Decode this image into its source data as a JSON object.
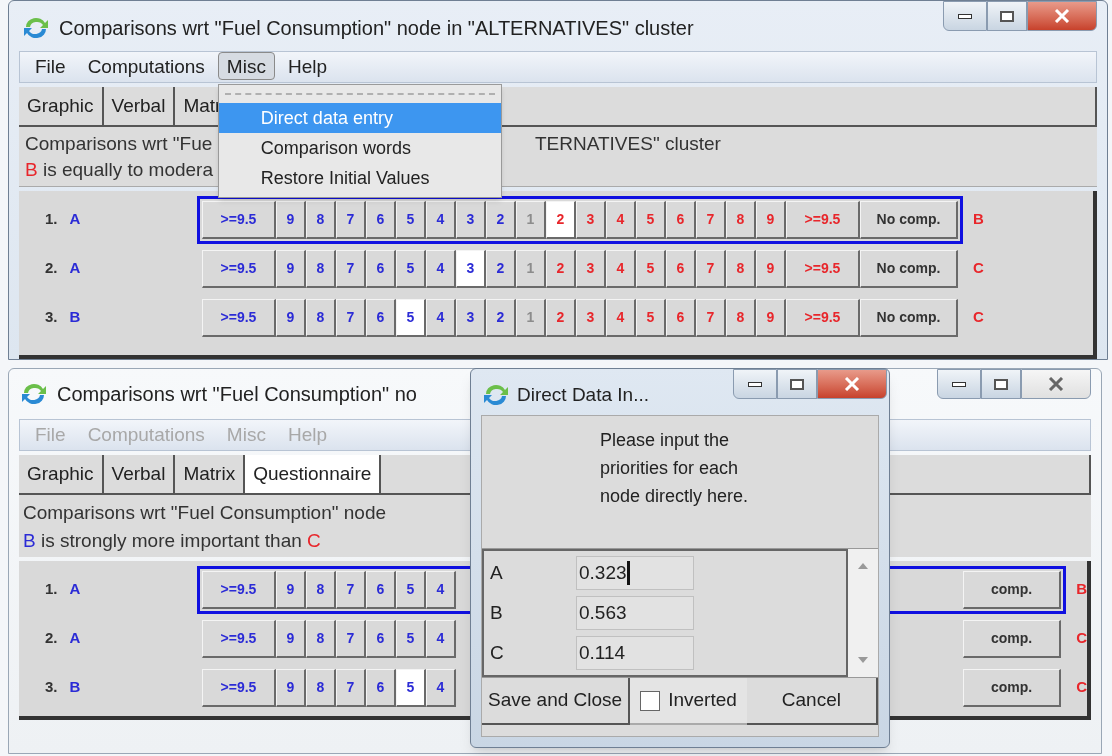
{
  "top_window": {
    "title": "Comparisons wrt \"Fuel Consumption\" node in \"ALTERNATIVES\" cluster",
    "menu": [
      {
        "label": "File",
        "open": false,
        "disabled": false
      },
      {
        "label": "Computations",
        "open": false,
        "disabled": false
      },
      {
        "label": "Misc",
        "open": true,
        "disabled": false
      },
      {
        "label": "Help",
        "open": false,
        "disabled": false
      }
    ],
    "dropdown": [
      {
        "label": "Direct data entry",
        "selected": true
      },
      {
        "label": "Comparison words",
        "selected": false
      },
      {
        "label": "Restore Initial Values",
        "selected": false
      }
    ],
    "tabs": [
      {
        "label": "Graphic",
        "selected": false
      },
      {
        "label": "Verbal",
        "selected": false
      },
      {
        "label": "Matr",
        "selected": false
      }
    ],
    "description": {
      "line1_left": "Comparisons wrt \"Fue",
      "line1_right": "TERNATIVES\" cluster",
      "line2": [
        {
          "text": "B",
          "color": "#e8262b"
        },
        {
          "text": " is equally to modera",
          "color": "#333333"
        }
      ]
    },
    "rows": [
      {
        "number": "1.",
        "left": "A",
        "right": "B",
        "focused": true,
        "cells": [
          {
            "label": ">=9.5",
            "kind": "maxmore",
            "selected": false
          },
          {
            "label": "9",
            "kind": "more",
            "selected": false
          },
          {
            "label": "8",
            "kind": "more",
            "selected": false
          },
          {
            "label": "7",
            "kind": "more",
            "selected": false
          },
          {
            "label": "6",
            "kind": "more",
            "selected": false
          },
          {
            "label": "5",
            "kind": "more",
            "selected": false
          },
          {
            "label": "4",
            "kind": "more",
            "selected": false
          },
          {
            "label": "3",
            "kind": "more",
            "selected": false
          },
          {
            "label": "2",
            "kind": "more",
            "selected": false
          },
          {
            "label": "1",
            "kind": "equal",
            "selected": false
          },
          {
            "label": "2",
            "kind": "less",
            "selected": true
          },
          {
            "label": "3",
            "kind": "less",
            "selected": false
          },
          {
            "label": "4",
            "kind": "less",
            "selected": false
          },
          {
            "label": "5",
            "kind": "less",
            "selected": false
          },
          {
            "label": "6",
            "kind": "less",
            "selected": false
          },
          {
            "label": "7",
            "kind": "less",
            "selected": false
          },
          {
            "label": "8",
            "kind": "less",
            "selected": false
          },
          {
            "label": "9",
            "kind": "less",
            "selected": false
          },
          {
            "label": ">=9.5",
            "kind": "maxless",
            "selected": false
          },
          {
            "label": "No comp.",
            "kind": "none",
            "selected": false
          }
        ]
      },
      {
        "number": "2.",
        "left": "A",
        "right": "C",
        "focused": false,
        "cells": [
          {
            "label": ">=9.5",
            "kind": "maxmore",
            "selected": false
          },
          {
            "label": "9",
            "kind": "more",
            "selected": false
          },
          {
            "label": "8",
            "kind": "more",
            "selected": false
          },
          {
            "label": "7",
            "kind": "more",
            "selected": false
          },
          {
            "label": "6",
            "kind": "more",
            "selected": false
          },
          {
            "label": "5",
            "kind": "more",
            "selected": false
          },
          {
            "label": "4",
            "kind": "more",
            "selected": false
          },
          {
            "label": "3",
            "kind": "more",
            "selected": true
          },
          {
            "label": "2",
            "kind": "more",
            "selected": false
          },
          {
            "label": "1",
            "kind": "equal",
            "selected": false
          },
          {
            "label": "2",
            "kind": "less",
            "selected": false
          },
          {
            "label": "3",
            "kind": "less",
            "selected": false
          },
          {
            "label": "4",
            "kind": "less",
            "selected": false
          },
          {
            "label": "5",
            "kind": "less",
            "selected": false
          },
          {
            "label": "6",
            "kind": "less",
            "selected": false
          },
          {
            "label": "7",
            "kind": "less",
            "selected": false
          },
          {
            "label": "8",
            "kind": "less",
            "selected": false
          },
          {
            "label": "9",
            "kind": "less",
            "selected": false
          },
          {
            "label": ">=9.5",
            "kind": "maxless",
            "selected": false
          },
          {
            "label": "No comp.",
            "kind": "none",
            "selected": false
          }
        ]
      },
      {
        "number": "3.",
        "left": "B",
        "right": "C",
        "focused": false,
        "cells": [
          {
            "label": ">=9.5",
            "kind": "maxmore",
            "selected": false
          },
          {
            "label": "9",
            "kind": "more",
            "selected": false
          },
          {
            "label": "8",
            "kind": "more",
            "selected": false
          },
          {
            "label": "7",
            "kind": "more",
            "selected": false
          },
          {
            "label": "6",
            "kind": "more",
            "selected": false
          },
          {
            "label": "5",
            "kind": "more",
            "selected": true
          },
          {
            "label": "4",
            "kind": "more",
            "selected": false
          },
          {
            "label": "3",
            "kind": "more",
            "selected": false
          },
          {
            "label": "2",
            "kind": "more",
            "selected": false
          },
          {
            "label": "1",
            "kind": "equal",
            "selected": false
          },
          {
            "label": "2",
            "kind": "less",
            "selected": false
          },
          {
            "label": "3",
            "kind": "less",
            "selected": false
          },
          {
            "label": "4",
            "kind": "less",
            "selected": false
          },
          {
            "label": "5",
            "kind": "less",
            "selected": false
          },
          {
            "label": "6",
            "kind": "less",
            "selected": false
          },
          {
            "label": "7",
            "kind": "less",
            "selected": false
          },
          {
            "label": "8",
            "kind": "less",
            "selected": false
          },
          {
            "label": "9",
            "kind": "less",
            "selected": false
          },
          {
            "label": ">=9.5",
            "kind": "maxless",
            "selected": false
          },
          {
            "label": "No comp.",
            "kind": "none",
            "selected": false
          }
        ]
      }
    ]
  },
  "bottom_window": {
    "title": "Comparisons wrt \"Fuel Consumption\" no",
    "menu": [
      {
        "label": "File",
        "open": false,
        "disabled": true
      },
      {
        "label": "Computations",
        "open": false,
        "disabled": true
      },
      {
        "label": "Misc",
        "open": false,
        "disabled": true
      },
      {
        "label": "Help",
        "open": false,
        "disabled": true
      }
    ],
    "tabs": [
      {
        "label": "Graphic",
        "selected": false
      },
      {
        "label": "Verbal",
        "selected": false
      },
      {
        "label": "Matrix",
        "selected": false
      },
      {
        "label": "Questionnaire",
        "selected": true
      }
    ],
    "description": {
      "line1_left": "Comparisons wrt \"Fuel Consumption\" node",
      "line2": [
        {
          "text": "B",
          "color": "#2b2bd6"
        },
        {
          "text": " is strongly more important than ",
          "color": "#333333"
        },
        {
          "text": "C",
          "color": "#e8262b"
        }
      ]
    },
    "rows": [
      {
        "number": "1.",
        "left": "A",
        "right": "B",
        "focused": true,
        "cells": [
          {
            "label": ">=9.5",
            "kind": "maxmore",
            "selected": false
          },
          {
            "label": "9",
            "kind": "more",
            "selected": false
          },
          {
            "label": "8",
            "kind": "more",
            "selected": false
          },
          {
            "label": "7",
            "kind": "more",
            "selected": false
          },
          {
            "label": "6",
            "kind": "more",
            "selected": false
          },
          {
            "label": "5",
            "kind": "more",
            "selected": false
          },
          {
            "label": "4",
            "kind": "more",
            "selected": false
          }
        ],
        "right_cells": [
          {
            "label": "comp.",
            "kind": "none",
            "selected": false
          }
        ]
      },
      {
        "number": "2.",
        "left": "A",
        "right": "C",
        "focused": false,
        "cells": [
          {
            "label": ">=9.5",
            "kind": "maxmore",
            "selected": false
          },
          {
            "label": "9",
            "kind": "more",
            "selected": false
          },
          {
            "label": "8",
            "kind": "more",
            "selected": false
          },
          {
            "label": "7",
            "kind": "more",
            "selected": false
          },
          {
            "label": "6",
            "kind": "more",
            "selected": false
          },
          {
            "label": "5",
            "kind": "more",
            "selected": false
          },
          {
            "label": "4",
            "kind": "more",
            "selected": false
          }
        ],
        "right_cells": [
          {
            "label": "comp.",
            "kind": "none",
            "selected": false
          }
        ]
      },
      {
        "number": "3.",
        "left": "B",
        "right": "C",
        "focused": false,
        "cells": [
          {
            "label": ">=9.5",
            "kind": "maxmore",
            "selected": false
          },
          {
            "label": "9",
            "kind": "more",
            "selected": false
          },
          {
            "label": "8",
            "kind": "more",
            "selected": false
          },
          {
            "label": "7",
            "kind": "more",
            "selected": false
          },
          {
            "label": "6",
            "kind": "more",
            "selected": false
          },
          {
            "label": "5",
            "kind": "more",
            "selected": true
          },
          {
            "label": "4",
            "kind": "more",
            "selected": false
          }
        ],
        "right_cells": [
          {
            "label": "comp.",
            "kind": "none",
            "selected": false
          }
        ]
      }
    ]
  },
  "dialog": {
    "title": "Direct Data In...",
    "message": "Please input the priorities for each node directly here.",
    "entries": [
      {
        "label": "A",
        "value": "0.323",
        "focused": true
      },
      {
        "label": "B",
        "value": "0.563",
        "focused": false
      },
      {
        "label": "C",
        "value": "0.114",
        "focused": false
      }
    ],
    "save_button": "Save and Close",
    "inverted": {
      "label": "Inverted",
      "checked": false
    },
    "cancel_button": "Cancel"
  }
}
